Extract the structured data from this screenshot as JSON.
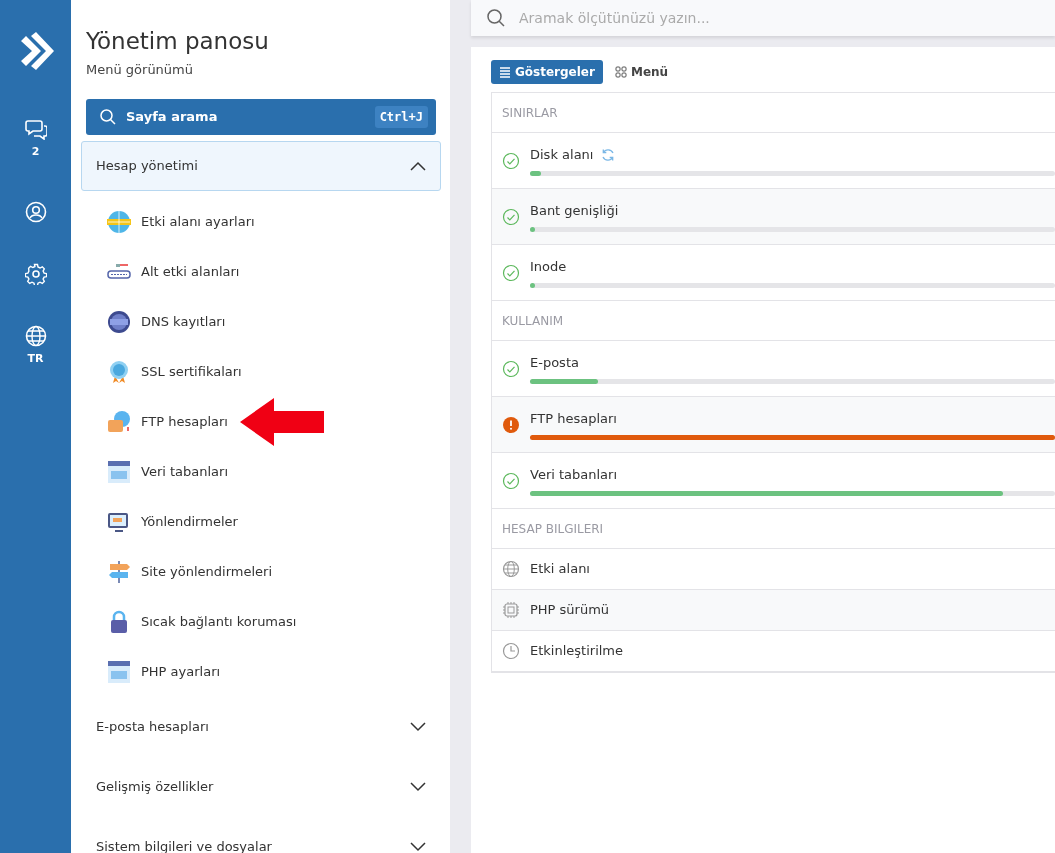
{
  "rail": {
    "chat_count": "2",
    "language": "TR"
  },
  "sidebar": {
    "title": "Yönetim panosu",
    "subtitle": "Menü görünümü",
    "search_button": {
      "label": "Sayfa arama",
      "shortcut": "Ctrl+J"
    },
    "sections": [
      {
        "label": "Hesap yönetimi",
        "expanded": true,
        "items": [
          {
            "label": "Etki alanı ayarları"
          },
          {
            "label": "Alt etki alanları"
          },
          {
            "label": "DNS kayıtları"
          },
          {
            "label": "SSL sertifikaları"
          },
          {
            "label": "FTP hesapları"
          },
          {
            "label": "Veri tabanları"
          },
          {
            "label": "Yönlendirmeler"
          },
          {
            "label": "Site yönlendirmeleri"
          },
          {
            "label": "Sıcak bağlantı koruması"
          },
          {
            "label": "PHP ayarları"
          }
        ]
      },
      {
        "label": "E-posta hesapları",
        "expanded": false
      },
      {
        "label": "Gelişmiş özellikler",
        "expanded": false
      },
      {
        "label": "Sistem bilgileri ve dosyalar",
        "expanded": false
      }
    ]
  },
  "search": {
    "placeholder": "Aramak ölçütünüzü yazın..."
  },
  "view_tabs": [
    {
      "label": "Göstergeler",
      "selected": true
    },
    {
      "label": "Menü",
      "selected": false
    }
  ],
  "groups": [
    {
      "heading": "SINIRLAR",
      "rows": [
        {
          "kind": "meter",
          "label": "Disk alanı",
          "warning": false,
          "level": 0.02,
          "refresh": true
        },
        {
          "kind": "meter",
          "label": "Bant genişliği",
          "warning": false,
          "level": 0.01
        },
        {
          "kind": "meter",
          "label": "Inode",
          "warning": false,
          "level": 0.01
        }
      ]
    },
    {
      "heading": "KULLANIM",
      "rows": [
        {
          "kind": "meter",
          "label": "E-posta",
          "warning": false,
          "level": 0.13
        },
        {
          "kind": "meter",
          "label": "FTP hesapları",
          "warning": true,
          "level": 1
        },
        {
          "kind": "meter",
          "label": "Veri tabanları",
          "warning": false,
          "level": 0.9
        }
      ]
    },
    {
      "heading": "HESAP BILGILERI",
      "rows": [
        {
          "kind": "info",
          "label": "Etki alanı"
        },
        {
          "kind": "info",
          "label": "PHP sürümü"
        },
        {
          "kind": "info",
          "label": "Etkinleştirilme"
        }
      ]
    }
  ]
}
